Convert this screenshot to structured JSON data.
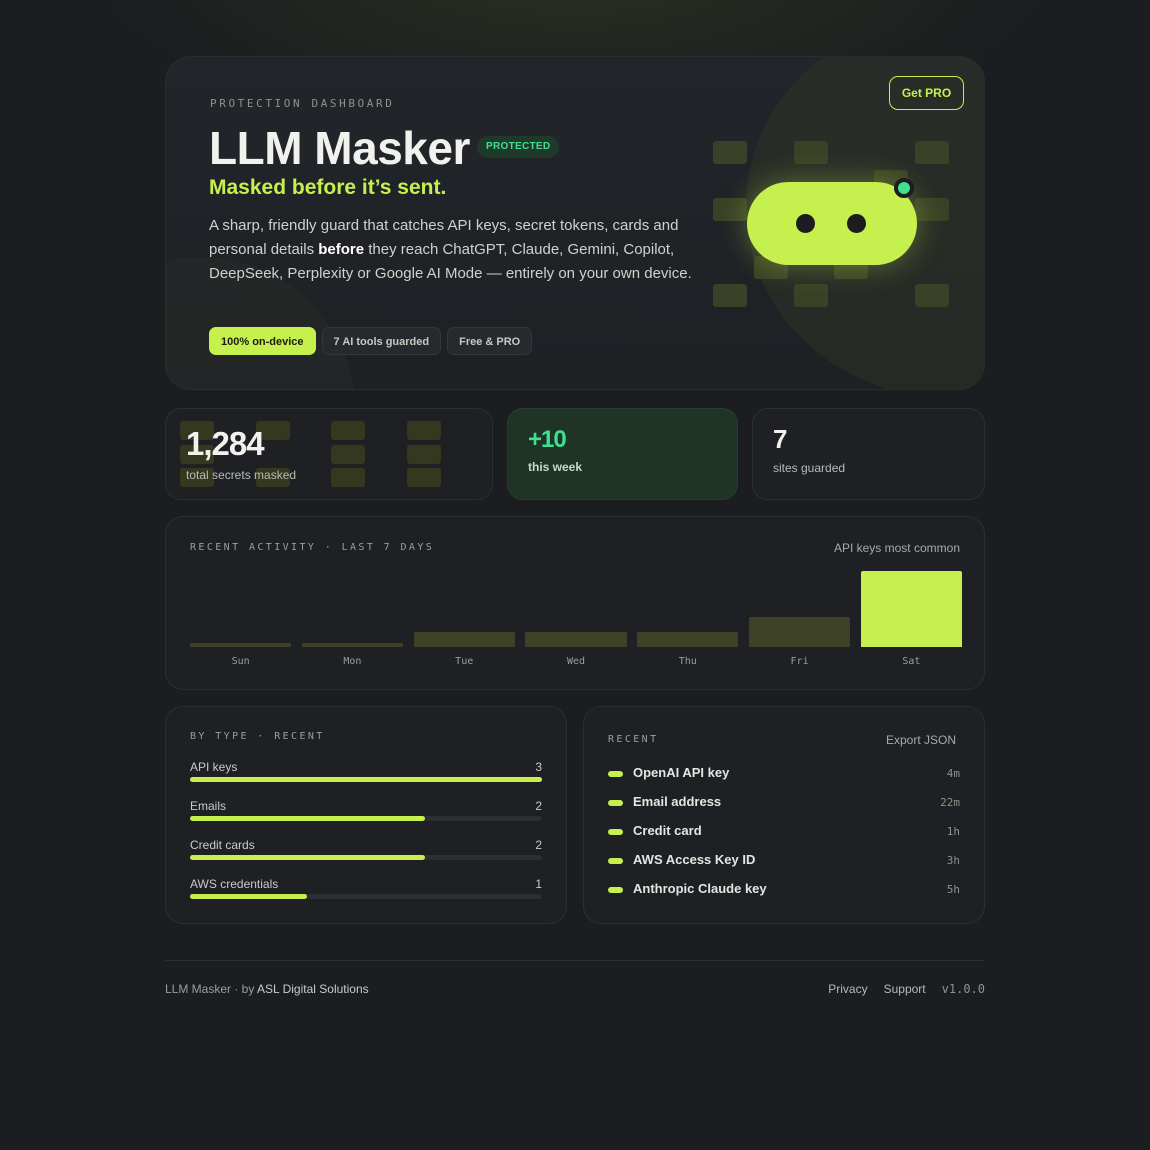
{
  "hero": {
    "eyebrow": "PROTECTION DASHBOARD",
    "title": "LLM Masker",
    "badge": "PROTECTED",
    "tagline": "Masked before it’s sent.",
    "desc_1": "A sharp, friendly guard that catches API keys, secret tokens, cards and personal details ",
    "desc_bold": "before",
    "desc_2": " they reach ChatGPT, Claude, Gemini, Copilot, DeepSeek, Perplexity or Google AI Mode — entirely on your own device.",
    "chips": [
      "100% on-device",
      "7 AI tools guarded",
      "Free & PRO"
    ],
    "cta": "Get PRO"
  },
  "stats": [
    {
      "value": "1,284",
      "label": "total secrets masked"
    },
    {
      "value": "+10",
      "label": "this week"
    },
    {
      "value": "7",
      "label": "sites guarded"
    }
  ],
  "activity": {
    "label": "RECENT ACTIVITY · LAST 7 DAYS",
    "note": "API keys most common",
    "chart_data": {
      "type": "bar",
      "categories": [
        "Sun",
        "Mon",
        "Tue",
        "Wed",
        "Thu",
        "Fri",
        "Sat"
      ],
      "values": [
        0.5,
        0.5,
        2,
        2,
        2,
        4,
        10
      ],
      "ylim": [
        0,
        10
      ]
    }
  },
  "by_type": {
    "label": "BY TYPE · RECENT",
    "max": 3,
    "items": [
      {
        "name": "API keys",
        "count": 3
      },
      {
        "name": "Emails",
        "count": 2
      },
      {
        "name": "Credit cards",
        "count": 2
      },
      {
        "name": "AWS credentials",
        "count": 1
      }
    ]
  },
  "recent": {
    "label": "RECENT",
    "export": "Export JSON",
    "items": [
      {
        "name": "OpenAI API key",
        "time": "4m"
      },
      {
        "name": "Email address",
        "time": "22m"
      },
      {
        "name": "Credit card",
        "time": "1h"
      },
      {
        "name": "AWS Access Key ID",
        "time": "3h"
      },
      {
        "name": "Anthropic Claude key",
        "time": "5h"
      }
    ]
  },
  "footer": {
    "left_prefix": "LLM Masker · by ",
    "brand": "ASL Digital Solutions",
    "privacy": "Privacy",
    "support": "Support",
    "version": "v1.0.0"
  },
  "colors": {
    "accent": "#c5f04e",
    "success": "#3fe08e",
    "background": "#1a1c1f"
  }
}
